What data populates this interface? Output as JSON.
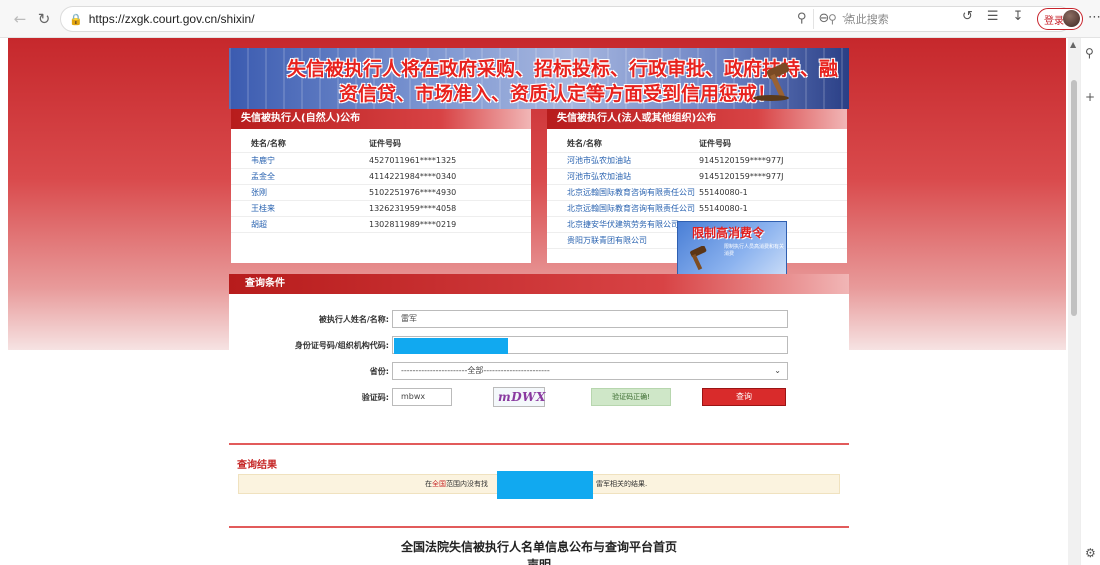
{
  "browser": {
    "url": "https://zxgk.court.gov.cn/shixin/",
    "search_placeholder": "点此搜索",
    "login_label": "登录"
  },
  "banner": {
    "line1": "失信被执行人将在政府采购、招标投标、行政审批、政府扶持、融",
    "line2": "资信贷、市场准入、资质认定等方面受到信用惩戒！"
  },
  "left_panel": {
    "title": "失信被执行人(自然人)公布",
    "col_name": "姓名/名称",
    "col_id": "证件号码",
    "rows": [
      {
        "name": "韦鹿宁",
        "id": "4527011961****1325"
      },
      {
        "name": "孟金全",
        "id": "4114221984****0340"
      },
      {
        "name": "张刚",
        "id": "5102251976****4930"
      },
      {
        "name": "王桂来",
        "id": "1326231959****4058"
      },
      {
        "name": "胡超",
        "id": "1302811989****0219"
      }
    ]
  },
  "right_panel": {
    "title": "失信被执行人(法人或其他组织)公布",
    "col_name": "姓名/名称",
    "col_id": "证件号码",
    "rows": [
      {
        "name": "河池市弘农加油站",
        "id": "9145120159****977J"
      },
      {
        "name": "河池市弘农加油站",
        "id": "9145120159****977J"
      },
      {
        "name": "北京远翰国际教育咨询有限责任公司",
        "id": "55140080-1"
      },
      {
        "name": "北京远翰国际教育咨询有限责任公司",
        "id": "55140080-1"
      },
      {
        "name": "北京捷安华伏建筑劳务有限公司",
        "id": ""
      },
      {
        "name": "贵阳万联青团有限公司",
        "id": ""
      }
    ],
    "ad_title": "限制高消费令",
    "ad_sub": "限制执行人员高消费和有关消费"
  },
  "query": {
    "title": "查询条件",
    "name_label": "被执行人姓名/名称:",
    "name_value": "雷军",
    "id_label": "身份证号码/组织机构代码:",
    "province_label": "省份:",
    "province_value": "-----------------------全部-----------------------",
    "captcha_label": "验证码:",
    "captcha_value": "mbwx",
    "captcha_image": "mDWX",
    "captcha_ok": "验证码正确!",
    "query_button": "查询"
  },
  "results": {
    "title": "查询结果",
    "prefix": "在",
    "scope": "全国",
    "middle": "范围内没有找",
    "keyword": "雷军",
    "suffix": "相关的结果."
  },
  "footer": {
    "title": "全国法院失信被执行人名单信息公布与查询平台首页",
    "subtitle": "声明"
  }
}
